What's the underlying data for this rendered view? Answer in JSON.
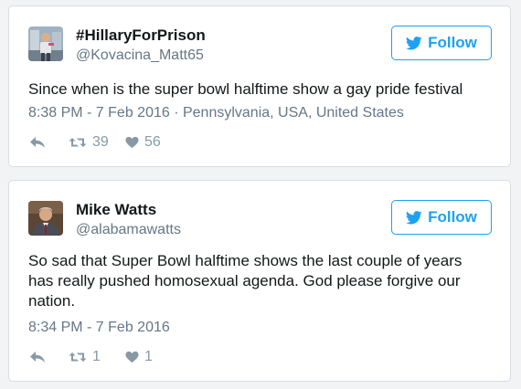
{
  "colors": {
    "accent": "#1da1f2",
    "name": "#14171a",
    "secondary": "#657786",
    "action_icon": "#8899a6",
    "card_border": "#d8dee3"
  },
  "tweets": [
    {
      "name": "#HillaryForPrison",
      "handle": "@Kovacina_Matt65",
      "follow_label": "Follow",
      "text": "Since when is the super bowl halftime show a gay pride festival",
      "meta": "8:38 PM - 7 Feb 2016 · Pennsylvania, USA, United States",
      "retweets": "39",
      "likes": "56",
      "icons": [
        "avatar-photo",
        "twitter-bird-icon",
        "reply-icon",
        "retweet-icon",
        "heart-icon"
      ]
    },
    {
      "name": "Mike Watts",
      "handle": "@alabamawatts",
      "follow_label": "Follow",
      "text": "So sad that Super Bowl halftime shows the last couple of years has really pushed homosexual agenda. God please forgive our nation.",
      "meta": "8:34 PM - 7 Feb 2016",
      "retweets": "1",
      "likes": "1",
      "icons": [
        "avatar-photo",
        "twitter-bird-icon",
        "reply-icon",
        "retweet-icon",
        "heart-icon"
      ]
    }
  ]
}
